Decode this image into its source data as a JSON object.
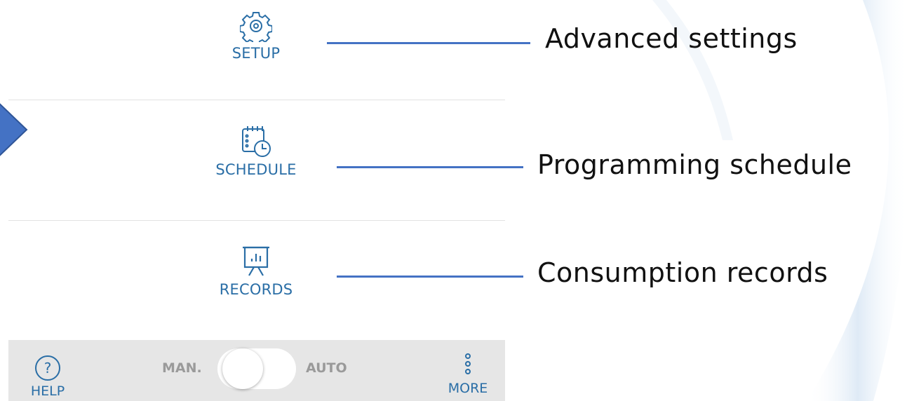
{
  "menu": {
    "setup": {
      "label": "SETUP",
      "icon": "gear-icon"
    },
    "schedule": {
      "label": "SCHEDULE",
      "icon": "calendar-clock-icon"
    },
    "records": {
      "label": "RECORDS",
      "icon": "presentation-chart-icon"
    }
  },
  "callouts": {
    "setup": "Advanced settings",
    "schedule": "Programming schedule",
    "records": "Consumption records"
  },
  "bottom_bar": {
    "help_label": "HELP",
    "mode_manual": "MAN.",
    "mode_auto": "AUTO",
    "more_label": "MORE",
    "toggle_state": "manual"
  },
  "colors": {
    "accent": "#2a6ea6",
    "connector": "#4472c4",
    "arrow": "#4472c4",
    "bar_bg": "#e6e6e6"
  }
}
